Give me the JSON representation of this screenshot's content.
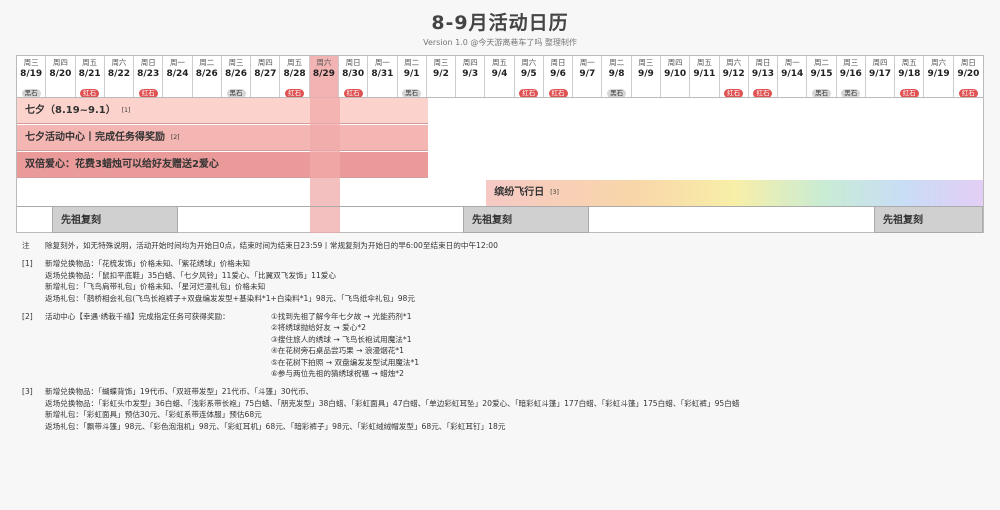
{
  "title": "8-9月活动日历",
  "subtitle": "Version 1.0 @今天游离巷车了吗 整理制作",
  "days": [
    {
      "w": "周三",
      "d": "8/19",
      "b": "黑石",
      "t": "black"
    },
    {
      "w": "周四",
      "d": "8/20",
      "b": "",
      "t": ""
    },
    {
      "w": "周五",
      "d": "8/21",
      "b": "红石",
      "t": "red"
    },
    {
      "w": "周六",
      "d": "8/22",
      "b": "",
      "t": ""
    },
    {
      "w": "周日",
      "d": "8/23",
      "b": "红石",
      "t": "red"
    },
    {
      "w": "周一",
      "d": "8/24",
      "b": "",
      "t": ""
    },
    {
      "w": "周二",
      "d": "8/26",
      "b": "",
      "t": ""
    },
    {
      "w": "周三",
      "d": "8/26",
      "b": "黑石",
      "t": "black"
    },
    {
      "w": "周四",
      "d": "8/27",
      "b": "",
      "t": ""
    },
    {
      "w": "周五",
      "d": "8/28",
      "b": "红石",
      "t": "red"
    },
    {
      "w": "周六",
      "d": "8/29",
      "b": "",
      "t": ""
    },
    {
      "w": "周日",
      "d": "8/30",
      "b": "红石",
      "t": "red"
    },
    {
      "w": "周一",
      "d": "8/31",
      "b": "",
      "t": ""
    },
    {
      "w": "周二",
      "d": "9/1",
      "b": "黑石",
      "t": "black"
    },
    {
      "w": "周三",
      "d": "9/2",
      "b": "",
      "t": ""
    },
    {
      "w": "周四",
      "d": "9/3",
      "b": "",
      "t": ""
    },
    {
      "w": "周五",
      "d": "9/4",
      "b": "",
      "t": ""
    },
    {
      "w": "周六",
      "d": "9/5",
      "b": "红石",
      "t": "red"
    },
    {
      "w": "周日",
      "d": "9/6",
      "b": "红石",
      "t": "red"
    },
    {
      "w": "周一",
      "d": "9/7",
      "b": "",
      "t": ""
    },
    {
      "w": "周二",
      "d": "9/8",
      "b": "黑石",
      "t": "black"
    },
    {
      "w": "周三",
      "d": "9/9",
      "b": "",
      "t": ""
    },
    {
      "w": "周四",
      "d": "9/10",
      "b": "",
      "t": ""
    },
    {
      "w": "周五",
      "d": "9/11",
      "b": "",
      "t": ""
    },
    {
      "w": "周六",
      "d": "9/12",
      "b": "红石",
      "t": "red"
    },
    {
      "w": "周日",
      "d": "9/13",
      "b": "红石",
      "t": "red"
    },
    {
      "w": "周一",
      "d": "9/14",
      "b": "",
      "t": ""
    },
    {
      "w": "周二",
      "d": "9/15",
      "b": "黑石",
      "t": "black"
    },
    {
      "w": "周三",
      "d": "9/16",
      "b": "黑石",
      "t": "black"
    },
    {
      "w": "周四",
      "d": "9/17",
      "b": "",
      "t": ""
    },
    {
      "w": "周五",
      "d": "9/18",
      "b": "红石",
      "t": "red"
    },
    {
      "w": "周六",
      "d": "9/19",
      "b": "",
      "t": ""
    },
    {
      "w": "周日",
      "d": "9/20",
      "b": "红石",
      "t": "red"
    }
  ],
  "highlight_index": 10,
  "events": {
    "qixi": "七夕（8.19~9.1）",
    "qixi_ref": "[1]",
    "center": "七夕活动中心丨完成任务得奖励",
    "center_ref": "[2]",
    "double": "双倍爱心：花费3蜡烛可以给好友赠送2爱心",
    "fly": "缤纷飞行日",
    "fly_ref": "[3]",
    "ancestor": "先祖复刻"
  },
  "notes": {
    "note_mark": "注",
    "note_text": "除复刻外，如无特殊说明，活动开始时间均为开始日0点，结束时间为结束日23:59丨常规复刻为开始日的早6:00至结束日的中午12:00",
    "n1_mark": "[1]",
    "n1": [
      "新增兑换物品：「花梳发饰」价格未知、「紫花绣球」价格未知",
      "返场兑换物品：「鼠扣平底鞋」35白蜡、「七夕风铃」11爱心、「比翼双飞发饰」11爱心",
      "新增礼包：「飞鸟肩带礼包」价格未知、「星河烂漫礼包」价格未知",
      "返场礼包：「鹊桥相会礼包(飞鸟长袍裤子+双盘编发发型+基染料*1+白染料*1」98元、「飞鸟纸伞礼包」98元"
    ],
    "n2_mark": "[2]",
    "n2_head": "活动中心【幸遇·绣栽千禧】完成指定任务可获得奖励：",
    "n2": [
      "①找到先祖了解今年七夕故 → 光能药剂*1",
      "②将绣球抛给好友 → 爱心*2",
      "③搜住旅人的绣球 → 飞鸟长袍试用魔法*1",
      "④在花树旁石桌品尝巧果 → 浪漫烟花*1",
      "⑤在花树下拍照 → 双盘编发发型试用魔法*1",
      "⑥参与两位先祖的猜绣球祝福 → 蜡烛*2"
    ],
    "n3_mark": "[3]",
    "n3": [
      "新增兑换物品：「蝴蝶背饰」19代币、「双班带发型」21代币、「斗篷」30代币、",
      "返场兑换物品：「彩虹头巾发型」36白蜡、「浅彩系带长袍」75白蜡、「朋克发型」38白蜡、「彩虹面具」47白蜡、「单边彩虹耳坠」20爱心、「暗彩虹斗篷」177白蜡、「彩虹斗篷」175白蜡、「彩虹裤」95白蜡",
      "新增礼包：「彩虹面具」预估30元、「彩虹系带连体服」预估68元",
      "返场礼包：「飘带斗篷」98元、「彩色泡泡机」98元、「彩虹耳机」68元、「暗彩裤子」98元、「彩虹绒绒帽发型」68元、「彩虹耳钉」18元"
    ]
  }
}
